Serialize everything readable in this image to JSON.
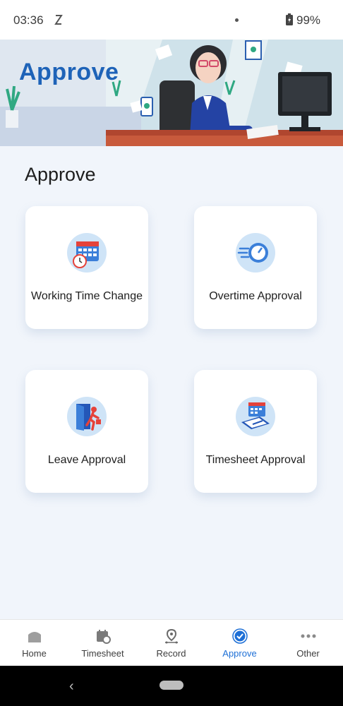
{
  "status_bar": {
    "time": "03:36",
    "battery": "99%"
  },
  "banner": {
    "title": "Approve"
  },
  "page": {
    "title": "Approve"
  },
  "cards": [
    {
      "label": "Working Time Change",
      "icon": "calendar-clock-icon"
    },
    {
      "label": "Overtime Approval",
      "icon": "speed-clock-icon"
    },
    {
      "label": "Leave Approval",
      "icon": "exit-door-icon"
    },
    {
      "label": "Timesheet Approval",
      "icon": "timesheet-sign-icon"
    }
  ],
  "bottom_nav": {
    "items": [
      {
        "label": "Home",
        "icon": "home-icon"
      },
      {
        "label": "Timesheet",
        "icon": "timesheet-icon"
      },
      {
        "label": "Record",
        "icon": "location-pin-icon"
      },
      {
        "label": "Approve",
        "icon": "check-circle-icon",
        "active": true
      },
      {
        "label": "Other",
        "icon": "more-dots-icon"
      }
    ]
  },
  "colors": {
    "accent": "#1d6fd6",
    "background": "#f1f5fb",
    "icon_circle": "#cfe4f7"
  }
}
